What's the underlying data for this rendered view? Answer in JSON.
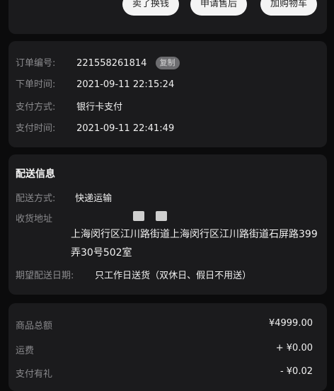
{
  "actions": {
    "exchange": "卖了换钱",
    "after_sales": "申请售后",
    "add_cart": "加购物车"
  },
  "order": {
    "number_label": "订单编号:",
    "number_value": "221558261814",
    "copy_label": "复制",
    "time_label": "下单时间:",
    "time_value": "2021-09-11 22:15:24",
    "pay_method_label": "支付方式:",
    "pay_method_value": "银行卡支付",
    "pay_time_label": "支付时间:",
    "pay_time_value": "2021-09-11 22:41:49"
  },
  "delivery": {
    "title": "配送信息",
    "method_label": "配送方式:",
    "method_value": "快递运输",
    "address_label": "收货地址",
    "address_value": "上海闵行区江川路街道上海闵行区江川路街道石屏路399弄30号502室",
    "date_label": "期望配送日期:",
    "date_value": "只工作日送货（双休日、假日不用送）"
  },
  "summary": {
    "total_label": "商品总额",
    "total_value": "¥4999.00",
    "shipping_label": "运费",
    "shipping_value": "+ ¥0.00",
    "gift_label": "支付有礼",
    "gift_value": "- ¥0.02"
  }
}
